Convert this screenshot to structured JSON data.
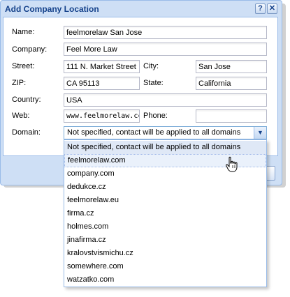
{
  "dialog": {
    "title": "Add Company Location",
    "help_label": "?",
    "close_label": "✕"
  },
  "labels": {
    "name": "Name:",
    "company": "Company:",
    "street": "Street:",
    "city": "City:",
    "zip": "ZIP:",
    "state": "State:",
    "country": "Country:",
    "web": "Web:",
    "phone": "Phone:",
    "domain": "Domain:"
  },
  "fields": {
    "name": "feelmorelaw San Jose",
    "company": "Feel More Law",
    "street": "111 N. Market Street",
    "city": "San Jose",
    "zip": "CA 95113",
    "state": "California",
    "country": "USA",
    "web": "www.feelmorelaw.cc",
    "phone": ""
  },
  "domain": {
    "selected": "Not specified, contact will be applied to all domains",
    "trigger_icon": "chevron-down-icon",
    "options": [
      "Not specified, contact will be applied to all domains",
      "feelmorelaw.com",
      "company.com",
      "dedukce.cz",
      "feelmorelaw.eu",
      "firma.cz",
      "holmes.com",
      "jinafirma.cz",
      "kralovstvismichu.cz",
      "somewhere.com",
      "watzatko.com"
    ]
  },
  "colors": {
    "title_text": "#15428b",
    "window_frame": "#cedff5",
    "border": "#99bbe8",
    "hover_row": "#eaf1fb"
  }
}
